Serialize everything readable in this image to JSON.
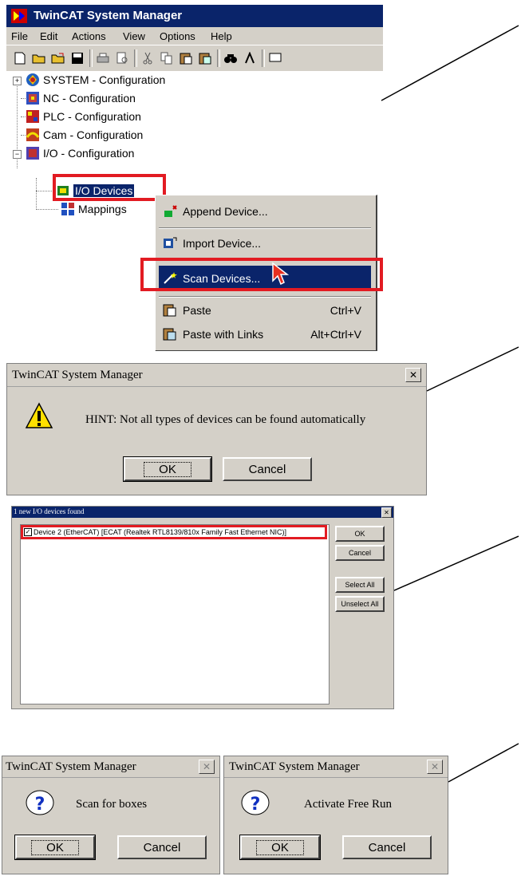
{
  "system_manager": {
    "title": "TwinCAT System Manager",
    "menu": [
      "File",
      "Edit",
      "Actions",
      "View",
      "Options",
      "Help"
    ],
    "tree": {
      "system": "SYSTEM - Configuration",
      "nc": "NC - Configuration",
      "plc": "PLC - Configuration",
      "cam": "Cam - Configuration",
      "io": "I/O - Configuration",
      "io_devices": "I/O Devices",
      "mappings": "Mappings"
    },
    "context_menu": {
      "append": "Append Device...",
      "import": "Import Device...",
      "scan": "Scan Devices...",
      "paste": "Paste",
      "paste_shortcut": "Ctrl+V",
      "paste_links": "Paste with Links",
      "paste_links_shortcut": "Alt+Ctrl+V"
    }
  },
  "hint_dialog": {
    "title": "TwinCAT System Manager",
    "message": "HINT: Not all types of devices can be found automatically",
    "ok": "OK",
    "cancel": "Cancel"
  },
  "devices_found_dialog": {
    "title": "1 new I/O devices found",
    "device_entry": "Device 2 (EtherCAT)     [ECAT (Realtek RTL8139/810x Family Fast Ethernet NIC)]",
    "device_checked": true,
    "ok": "OK",
    "cancel": "Cancel",
    "select_all": "Select All",
    "unselect_all": "Unselect All"
  },
  "scan_boxes_dialog": {
    "title": "TwinCAT System Manager",
    "message": "Scan for boxes",
    "ok": "OK",
    "cancel": "Cancel"
  },
  "free_run_dialog": {
    "title": "TwinCAT System Manager",
    "message": "Activate Free Run",
    "ok": "OK",
    "cancel": "Cancel"
  },
  "colors": {
    "titlebar_active": "#0a246a",
    "titlebar_inactive": "#808080",
    "highlight_box": "#e21b22",
    "dialog_face": "#d4d0c8"
  }
}
